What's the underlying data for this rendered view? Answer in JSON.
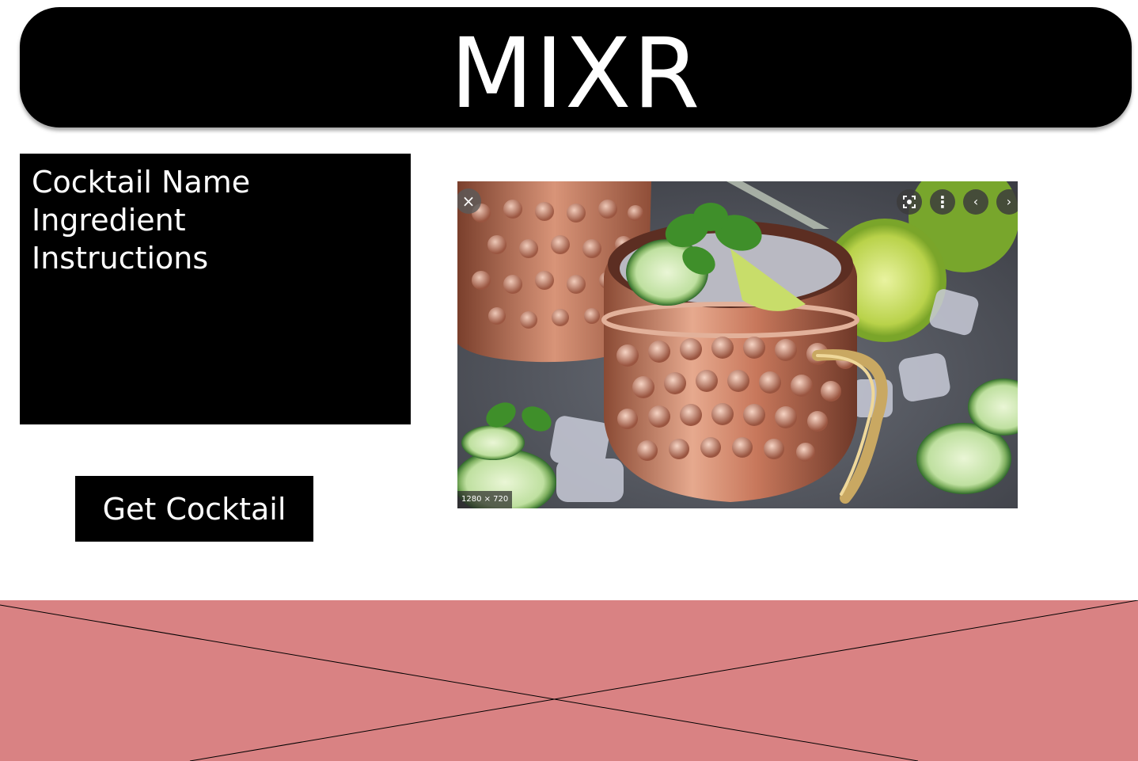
{
  "header": {
    "title": "MIXR"
  },
  "info_box": {
    "lines": [
      "Cocktail Name",
      "Ingredient",
      "Instructions"
    ]
  },
  "actions": {
    "get_cocktail_label": "Get Cocktail"
  },
  "image_viewer": {
    "size_label": "1280 × 720",
    "controls": {
      "close_glyph": "×",
      "lens_icon": "visual-search-icon",
      "more_glyph": "⋮",
      "prev_glyph": "‹",
      "next_glyph": "›"
    }
  },
  "colors": {
    "header_bg": "#000000",
    "text_light": "#ffffff",
    "placeholder_bg": "#d98283"
  }
}
